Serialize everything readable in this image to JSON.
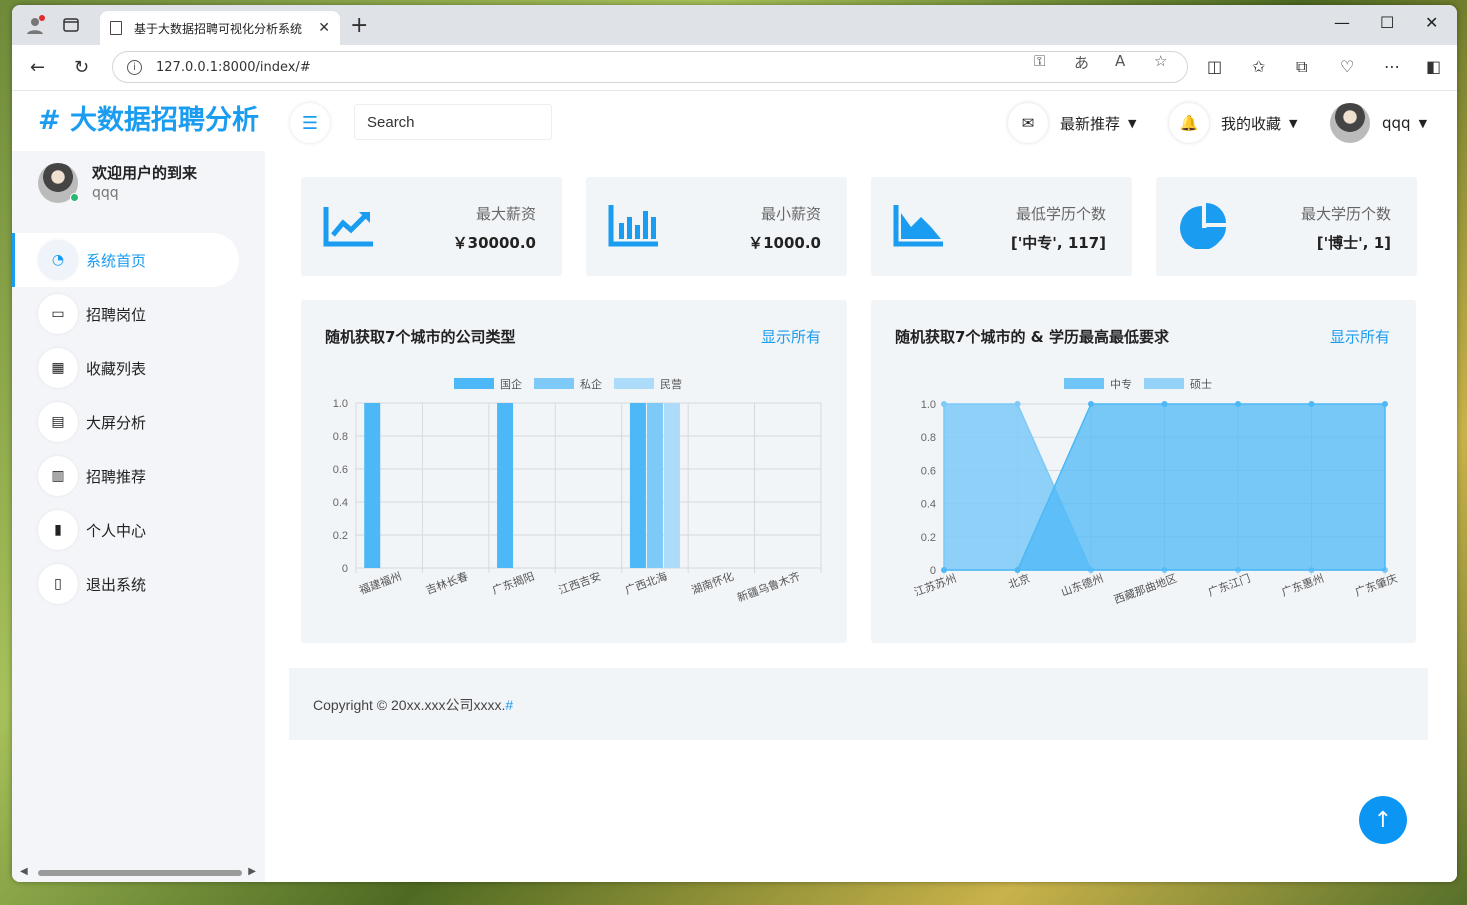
{
  "browser": {
    "tab_title": "基于大数据招聘可视化分析系统",
    "url": "127.0.0.1:8000/index/#"
  },
  "header": {
    "logo": "# 大数据招聘分析",
    "search_placeholder": "Search",
    "recommend": "最新推荐",
    "favorites": "我的收藏",
    "username": "qqq"
  },
  "sidebar": {
    "welcome": "欢迎用户的到来",
    "username": "qqq",
    "items": [
      {
        "label": "系统首页",
        "icon": "dashboard-icon",
        "glyph": "◔"
      },
      {
        "label": "招聘岗位",
        "icon": "laptop-icon",
        "glyph": "▭"
      },
      {
        "label": "收藏列表",
        "icon": "grid-icon",
        "glyph": "▦"
      },
      {
        "label": "大屏分析",
        "icon": "keyboard-icon",
        "glyph": "▤"
      },
      {
        "label": "招聘推荐",
        "icon": "table-icon",
        "glyph": "▥"
      },
      {
        "label": "个人中心",
        "icon": "bar-chart-icon",
        "glyph": "▮"
      },
      {
        "label": "退出系统",
        "icon": "file-icon",
        "glyph": "▯"
      }
    ]
  },
  "cards": [
    {
      "title": "最大薪资",
      "value": "￥30000.0",
      "icon": "line-chart-icon"
    },
    {
      "title": "最小薪资",
      "value": "￥1000.0",
      "icon": "bar-chart-icon"
    },
    {
      "title": "最低学历个数",
      "value": "['中专', 117]",
      "icon": "area-chart-icon"
    },
    {
      "title": "最大学历个数",
      "value": "['博士', 1]",
      "icon": "pie-chart-icon"
    }
  ],
  "panels": [
    {
      "title": "随机获取7个城市的公司类型",
      "link": "显示所有"
    },
    {
      "title": "随机获取7个城市的 & 学历最高最低要求",
      "link": "显示所有"
    }
  ],
  "footer": {
    "text": "Copyright © 20xx.xxx公司xxxx.",
    "link": "#"
  },
  "colors": {
    "accent": "#1a9cf0",
    "series1": "#4db8f7",
    "series2": "#7dc9f8",
    "series3": "#acdcf9"
  },
  "chart_data": [
    {
      "type": "bar",
      "categories": [
        "福建福州",
        "吉林长春",
        "广东揭阳",
        "江西吉安",
        "广西北海",
        "湖南怀化",
        "新疆乌鲁木齐"
      ],
      "series": [
        {
          "name": "国企",
          "values": [
            1,
            0,
            1,
            0,
            1,
            0,
            0
          ]
        },
        {
          "name": "私企",
          "values": [
            0,
            0,
            0,
            0,
            1,
            0,
            0
          ]
        },
        {
          "name": "民营",
          "values": [
            0,
            0,
            0,
            0,
            1,
            0,
            0
          ]
        }
      ],
      "ylim": [
        0,
        1
      ],
      "yticks": [
        "0",
        "0.2",
        "0.4",
        "0.6",
        "0.8",
        "1.0"
      ],
      "legend": "top-center",
      "grid": true
    },
    {
      "type": "area",
      "categories": [
        "江苏苏州",
        "北京",
        "山东德州",
        "西藏那曲地区",
        "广东江门",
        "广东惠州",
        "广东肇庆"
      ],
      "series": [
        {
          "name": "中专",
          "values": [
            0,
            0,
            1,
            1,
            1,
            1,
            1
          ]
        },
        {
          "name": "硕士",
          "values": [
            1,
            1,
            0,
            0,
            0,
            0,
            0
          ]
        }
      ],
      "ylim": [
        0,
        1
      ],
      "yticks": [
        "0",
        "0.2",
        "0.4",
        "0.6",
        "0.8",
        "1.0"
      ],
      "legend": "top-center",
      "grid": true
    }
  ]
}
